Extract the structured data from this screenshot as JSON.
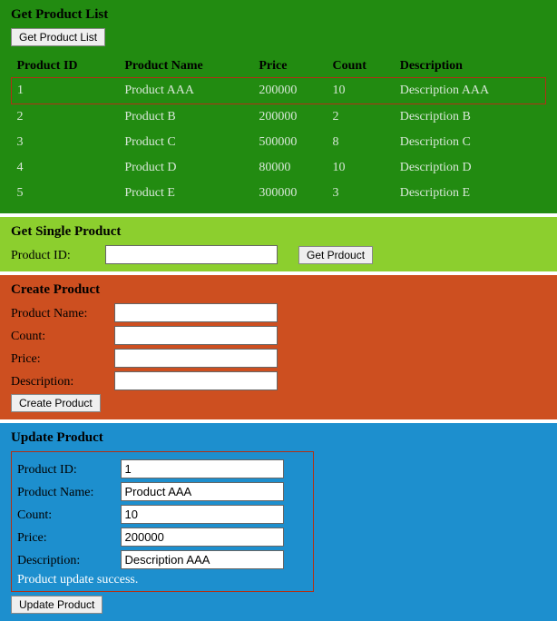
{
  "getList": {
    "title": "Get Product List",
    "button": "Get Product List",
    "columns": [
      "Product ID",
      "Product Name",
      "Price",
      "Count",
      "Description"
    ],
    "rows": [
      {
        "id": "1",
        "name": "Product AAA",
        "price": "200000",
        "count": "10",
        "desc": "Description AAA"
      },
      {
        "id": "2",
        "name": "Product B",
        "price": "200000",
        "count": "2",
        "desc": "Description B"
      },
      {
        "id": "3",
        "name": "Product C",
        "price": "500000",
        "count": "8",
        "desc": "Description C"
      },
      {
        "id": "4",
        "name": "Product D",
        "price": "80000",
        "count": "10",
        "desc": "Description D"
      },
      {
        "id": "5",
        "name": "Product E",
        "price": "300000",
        "count": "3",
        "desc": "Description E"
      }
    ]
  },
  "getSingle": {
    "title": "Get Single Product",
    "label": "Product ID:",
    "value": "",
    "button": "Get Prdouct"
  },
  "create": {
    "title": "Create Product",
    "labels": {
      "name": "Product Name:",
      "count": "Count:",
      "price": "Price:",
      "desc": "Description:"
    },
    "values": {
      "name": "",
      "count": "",
      "price": "",
      "desc": ""
    },
    "button": "Create Product"
  },
  "update": {
    "title": "Update Product",
    "labels": {
      "id": "Product ID:",
      "name": "Product Name:",
      "count": "Count:",
      "price": "Price:",
      "desc": "Description:"
    },
    "values": {
      "id": "1",
      "name": "Product AAA",
      "count": "10",
      "price": "200000",
      "desc": "Description AAA"
    },
    "status": "Product update success.",
    "button": "Update Product"
  }
}
